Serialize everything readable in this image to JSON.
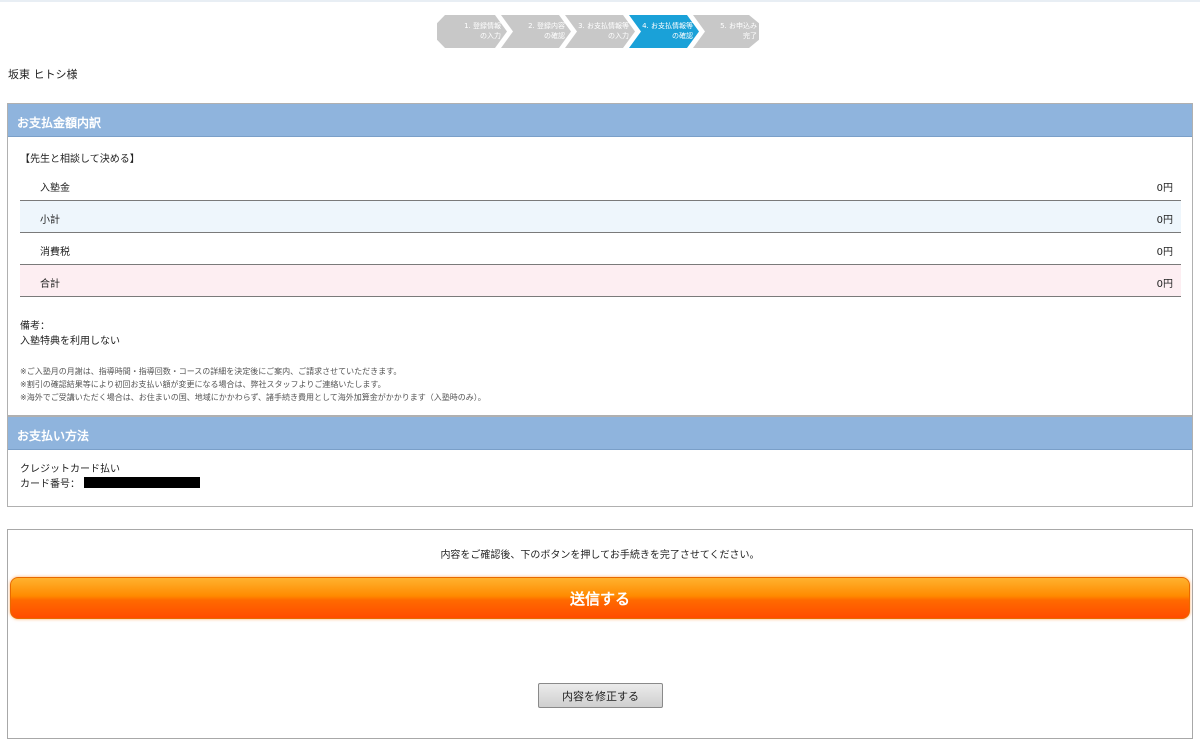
{
  "steps": [
    {
      "line1": "1. 登録情報",
      "line2": "の入力"
    },
    {
      "line1": "2. 登録内容",
      "line2": "の確認"
    },
    {
      "line1": "3. お支払情報等",
      "line2": "の入力"
    },
    {
      "line1": "4. お支払情報等",
      "line2": "の確認"
    },
    {
      "line1": "5. お申込み",
      "line2": "完了"
    }
  ],
  "customer_name": "坂東 ヒトシ様",
  "breakdown": {
    "header": "お支払金額内訳",
    "plan": "【先生と相談して決める】",
    "rows": [
      {
        "label": "入塾金",
        "value": "0円"
      },
      {
        "label": "小計",
        "value": "0円"
      },
      {
        "label": "消費税",
        "value": "0円"
      },
      {
        "label": "合計",
        "value": "0円"
      }
    ],
    "memo_label": "備考：",
    "memo_value": "入塾特典を利用しない",
    "notes": [
      "※ご入塾月の月謝は、指導時間・指導回数・コースの詳細を決定後にご案内、ご請求させていただきます。",
      "※割引の確認結果等により初回お支払い額が変更になる場合は、弊社スタッフよりご連絡いたします。",
      "※海外でご受講いただく場合は、お住まいの国、地域にかかわらず、諸手続き費用として海外加算金がかかります（入塾時のみ）。"
    ]
  },
  "payment": {
    "header": "お支払い方法",
    "method": "クレジットカード払い",
    "card_label": "カード番号："
  },
  "confirm": {
    "message": "内容をご確認後、下のボタンを押してお手続きを完了させてください。",
    "submit_label": "送信する",
    "edit_label": "内容を修正する"
  }
}
